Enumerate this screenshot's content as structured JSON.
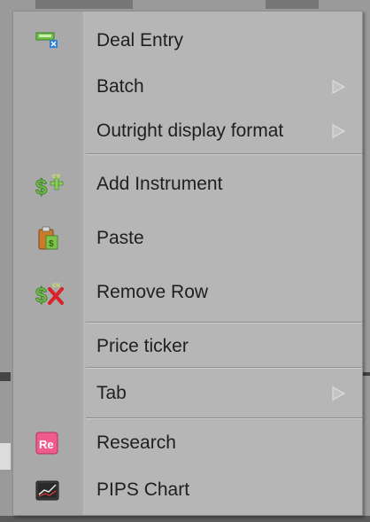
{
  "menu": {
    "items": [
      {
        "label": "Deal Entry",
        "icon": "deal-entry-icon",
        "submenu": false
      },
      {
        "label": "Batch",
        "icon": "",
        "submenu": true
      },
      {
        "label": "Outright display format",
        "icon": "",
        "submenu": true
      },
      {
        "label": "Add Instrument",
        "icon": "add-instrument-icon",
        "submenu": false
      },
      {
        "label": "Paste",
        "icon": "paste-icon",
        "submenu": false
      },
      {
        "label": "Remove Row",
        "icon": "remove-row-icon",
        "submenu": false
      },
      {
        "label": "Price ticker",
        "icon": "",
        "submenu": false
      },
      {
        "label": "Tab",
        "icon": "",
        "submenu": true
      },
      {
        "label": "Research",
        "icon": "research-icon",
        "submenu": false
      },
      {
        "label": "PIPS Chart",
        "icon": "pips-chart-icon",
        "submenu": false
      }
    ],
    "research_icon_text": "Re"
  },
  "colors": {
    "menu_bg": "#b6b6b6",
    "gutter_bg": "#a9a9a9",
    "text": "#1f1f1f",
    "green_icon": "#7ec34a",
    "red_x": "#d8232a",
    "research_pink": "#f05a8c"
  }
}
